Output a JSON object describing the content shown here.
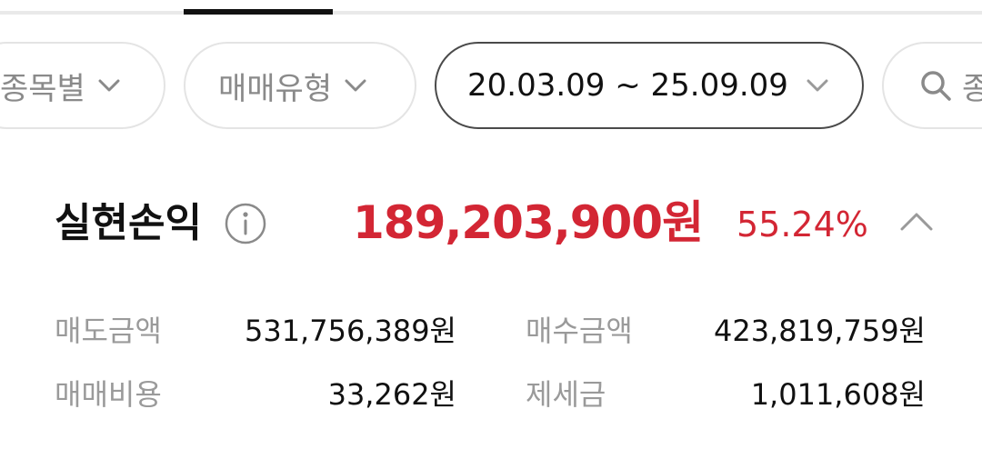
{
  "filters": {
    "item": "종목별",
    "trade_type": "매매유형",
    "date_range": "20.03.09 ~ 25.09.09",
    "search_placeholder": "종"
  },
  "summary": {
    "label": "실현손익",
    "amount": "189,203,900원",
    "rate": "55.24%"
  },
  "details": {
    "sell_amount_label": "매도금액",
    "sell_amount_value": "531,756,389원",
    "buy_amount_label": "매수금액",
    "buy_amount_value": "423,819,759원",
    "trade_cost_label": "매매비용",
    "trade_cost_value": "33,262원",
    "tax_label": "제세금",
    "tax_value": "1,011,608원"
  },
  "colors": {
    "accent_red": "#d32634",
    "text_dark": "#111111",
    "text_muted": "#9a9a9a",
    "chip_border": "#e4e4e4"
  },
  "icons": {
    "dropdown": "chevron-down-icon",
    "search": "search-icon",
    "info": "info-icon",
    "collapse": "chevron-up-icon"
  }
}
